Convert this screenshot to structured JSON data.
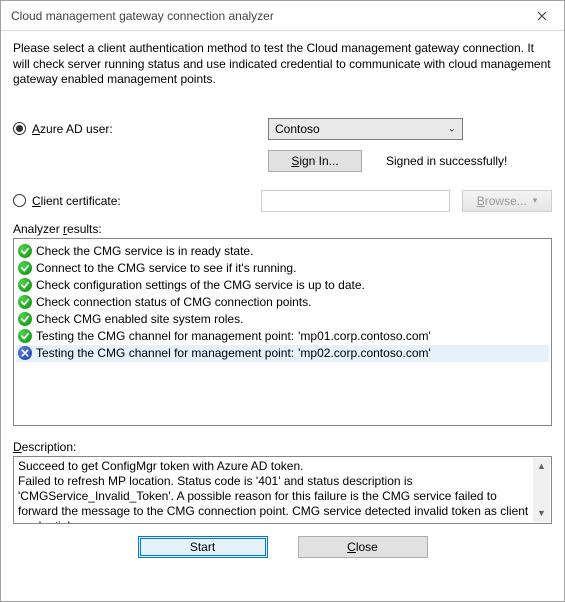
{
  "window": {
    "title": "Cloud management gateway connection analyzer"
  },
  "intro": "Please select a client authentication method to test the Cloud management gateway connection. It will check server running status and use indicated credential to communicate with cloud management gateway enabled management points.",
  "auth": {
    "radio_azure_label": "Azure AD user:",
    "azure_selected": "Contoso",
    "sign_in_label": "Sign In...",
    "signed_in_text": "Signed in successfully!",
    "radio_cert_label": "Client certificate:",
    "cert_value": "",
    "browse_label": "Browse..."
  },
  "results": {
    "label": "Analyzer results:",
    "items": [
      {
        "status": "ok",
        "text": "Check the CMG service is in ready state.",
        "mp": ""
      },
      {
        "status": "ok",
        "text": "Connect to the CMG service to see if it's running.",
        "mp": ""
      },
      {
        "status": "ok",
        "text": "Check configuration settings of the CMG service is up to date.",
        "mp": ""
      },
      {
        "status": "ok",
        "text": "Check connection status of CMG connection points.",
        "mp": ""
      },
      {
        "status": "ok",
        "text": "Check CMG enabled site system roles.",
        "mp": ""
      },
      {
        "status": "ok",
        "text": "Testing the CMG channel for management point:",
        "mp": "'mp01.corp.contoso.com'"
      },
      {
        "status": "err",
        "text": "Testing the CMG channel for management point:",
        "mp": "'mp02.corp.contoso.com'",
        "selected": true
      }
    ]
  },
  "description": {
    "label": "Description:",
    "text": "Succeed to get ConfigMgr token with Azure AD token.\nFailed to refresh MP location. Status code is '401' and status description is 'CMGService_Invalid_Token'. A possible reason for this failure is the CMG service failed to forward the message to the CMG connection point. CMG service detected invalid token as client credential."
  },
  "buttons": {
    "start": "Start",
    "close": "Close"
  }
}
